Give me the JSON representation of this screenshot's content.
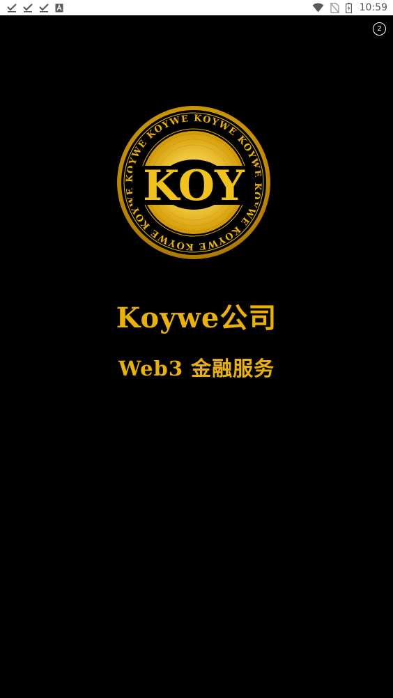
{
  "status_bar": {
    "time": "10:59",
    "left_icons": [
      "check-icon",
      "check-icon",
      "check-icon",
      "text-a-icon"
    ],
    "right_icons": [
      "wifi-icon",
      "no-sim-icon",
      "battery-charging-icon"
    ]
  },
  "splash": {
    "countdown": "2",
    "logo": {
      "main_text": "KOY",
      "ring_text": "KOYWE KOYWE KOYWE KOYWE KOYWE KOYWE KOYWE KOYWE"
    },
    "company_name": "Koywe公司",
    "tagline": "Web3 金融服务"
  },
  "colors": {
    "background": "#000000",
    "gold": "#e8b10b",
    "gold_light": "#f5cf3a",
    "statusbar_bg": "#ffffff",
    "statusbar_icon": "#5a5a5a"
  }
}
